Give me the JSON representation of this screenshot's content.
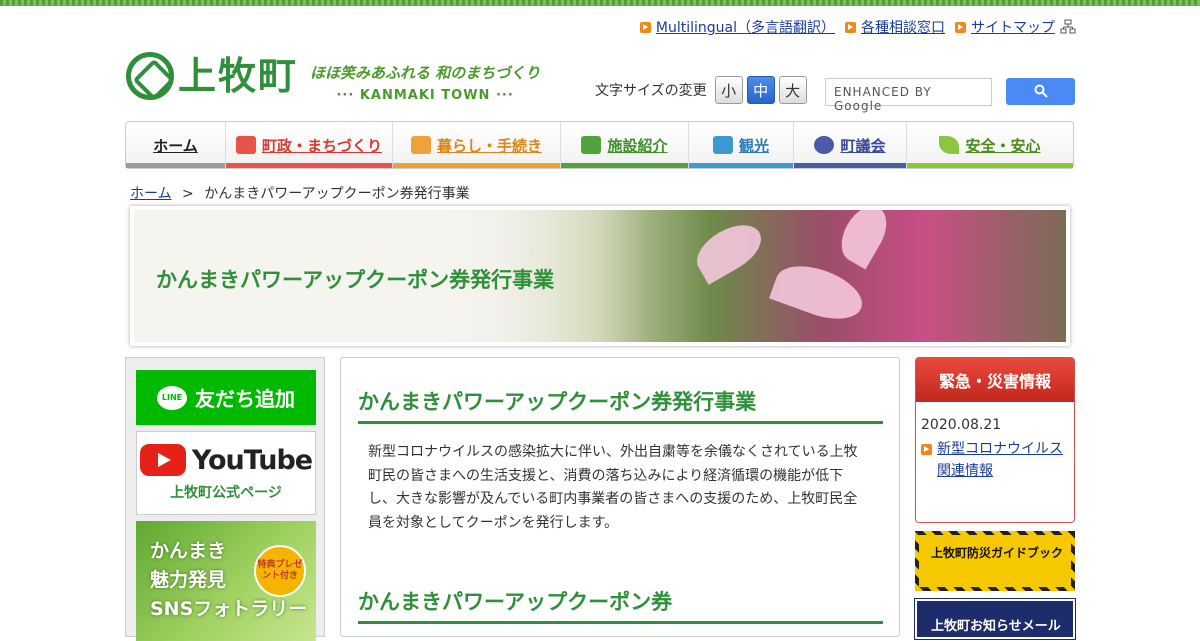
{
  "utility": [
    {
      "label": "Multilingual（多言語翻訳）"
    },
    {
      "label": "各種相談窓口"
    },
    {
      "label": "サイトマップ"
    }
  ],
  "logo": {
    "name": "上牧町",
    "tagline": "ほほ笑みあふれる 和のまちづくり",
    "sub": "··· KANMAKI TOWN ···"
  },
  "font_size": {
    "label": "文字サイズの変更",
    "small": "小",
    "medium": "中",
    "large": "大"
  },
  "search": {
    "placeholder": "ENHANCED BY Google"
  },
  "nav": [
    {
      "label": "ホーム",
      "color": "#9a9a9a"
    },
    {
      "label": "町政・まちづくり",
      "color": "#e8534a"
    },
    {
      "label": "暮らし・手続き",
      "color": "#efa23a"
    },
    {
      "label": "施設紹介",
      "color": "#52a33b"
    },
    {
      "label": "観光",
      "color": "#3d9ad1"
    },
    {
      "label": "町議会",
      "color": "#4c5aa8"
    },
    {
      "label": "安全・安心",
      "color": "#8cc63e"
    }
  ],
  "breadcrumb": {
    "home": "ホーム",
    "sep": ">",
    "current": "かんまきパワーアップクーポン券発行事業"
  },
  "hero": {
    "title": "かんまきパワーアップクーポン券発行事業"
  },
  "sidebar": {
    "line": "友だち追加",
    "line_logo": "LINE",
    "youtube": "YouTube",
    "youtube_caption": "上牧町公式ページ",
    "sns_line1": "かんまき",
    "sns_line2": "魅力発見",
    "sns_line3": "SNSフォトラリー",
    "badge": "特典プレゼント付き"
  },
  "main": {
    "heading1": "かんまきパワーアップクーポン券発行事業",
    "body": "新型コロナウイルスの感染拡大に伴い、外出自粛等を余儀なくされている上牧町民の皆さまへの生活支援と、消費の落ち込みにより経済循環の機能が低下し、大きな影響が及んでいる町内事業者の皆さまへの支援のため、上牧町民全員を対象としてクーポンを発行します。",
    "heading2": "かんまきパワーアップクーポン券"
  },
  "emergency": {
    "title": "緊急・災害情報",
    "date": "2020.08.21",
    "link": "新型コロナウイルス関連情報"
  },
  "banners": {
    "disaster": "上牧町防災ガイドブック",
    "mail": "上牧町お知らせメール"
  }
}
